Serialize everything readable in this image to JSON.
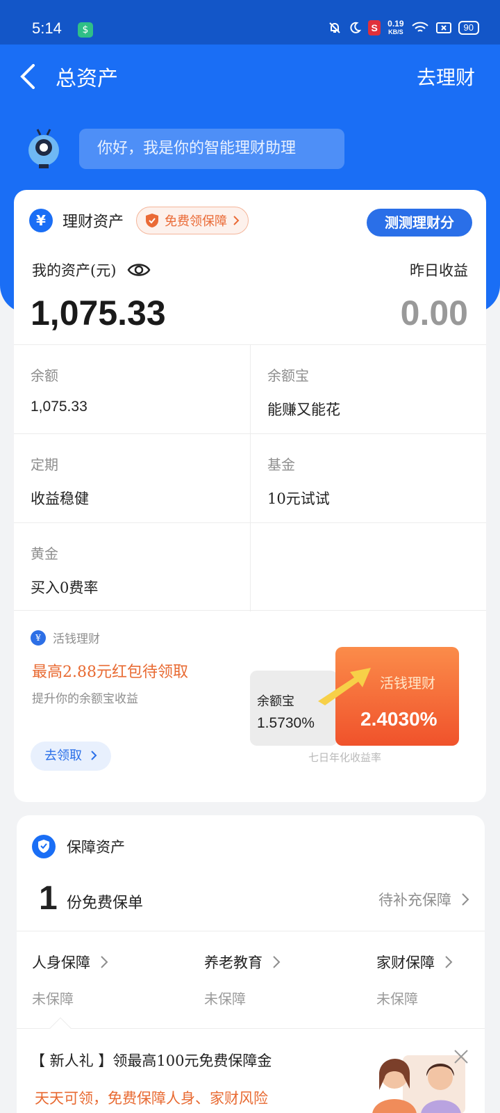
{
  "status_bar": {
    "time": "5:14",
    "speed_value": "0.19",
    "speed_unit": "KB/S",
    "battery": "90"
  },
  "nav": {
    "title": "总资产",
    "right_action": "去理财"
  },
  "assistant": {
    "greeting": "你好，我是你的智能理财助理"
  },
  "wealth": {
    "title": "理财资产",
    "free_badge": "免费领保障",
    "test_button": "测测理财分",
    "my_assets_label": "我的资产(元)",
    "yesterday_label": "昨日收益",
    "total": "1,075.33",
    "yesterday_value": "0.00",
    "items": [
      {
        "label": "余额",
        "value": "1,075.33"
      },
      {
        "label": "余额宝",
        "value": "能赚又能花"
      },
      {
        "label": "定期",
        "value": "收益稳健"
      },
      {
        "label": "基金",
        "value": "10元试试"
      },
      {
        "label": "黄金",
        "value": "买入0费率"
      }
    ]
  },
  "promo": {
    "brand": "活钱理财",
    "title": "最高2.88元红包待领取",
    "subtitle": "提升你的余额宝收益",
    "button": "去领取",
    "left_label": "余额宝",
    "left_value": "1.5730%",
    "right_label": "活钱理财",
    "right_value": "2.4030%",
    "note": "七日年化收益率"
  },
  "insurance": {
    "title": "保障资产",
    "count": "1",
    "count_label": "份免费保单",
    "pending": "待补充保障",
    "items": [
      {
        "label": "人身保障",
        "value": "未保障"
      },
      {
        "label": "养老教育",
        "value": "未保障"
      },
      {
        "label": "家财保障",
        "value": "未保障"
      }
    ]
  },
  "banner": {
    "title": "【 新人礼 】领最高100元免费保障金",
    "subtitle": "天天可领，免费保障人身、家财风险"
  },
  "colors": {
    "primary": "#1a6ef5",
    "accent_orange": "#e86a32"
  }
}
